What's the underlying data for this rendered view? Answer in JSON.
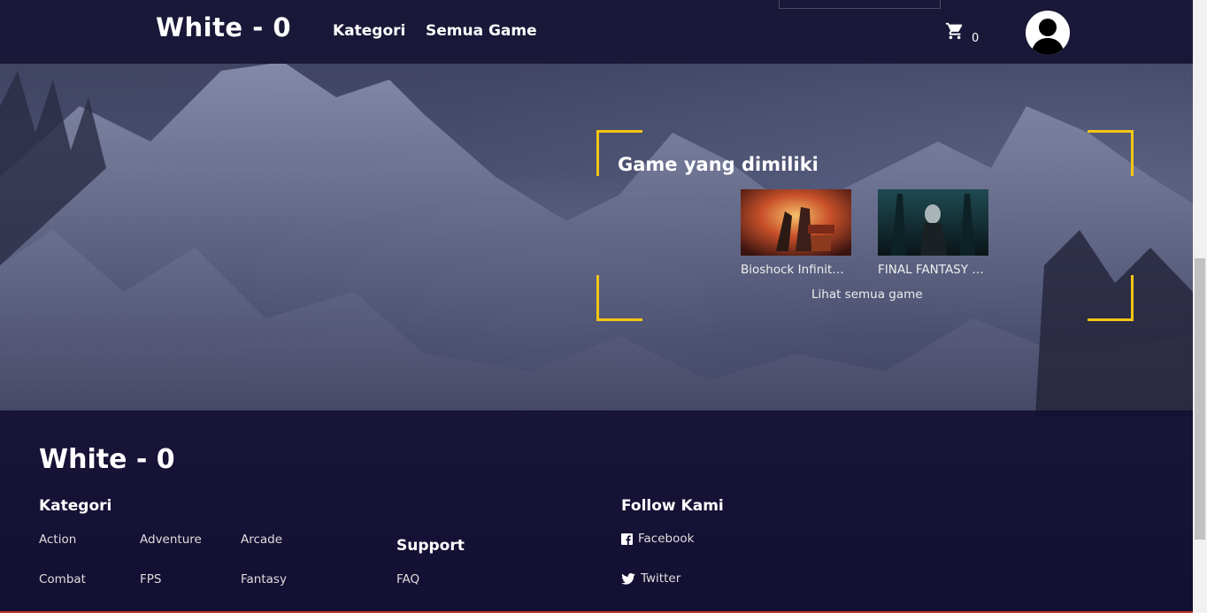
{
  "header": {
    "logo": "White - 0",
    "nav": [
      {
        "label": "Kategori"
      },
      {
        "label": "Semua Game"
      }
    ],
    "cart_count": "0"
  },
  "owned": {
    "title": "Game yang dimiliki",
    "games": [
      {
        "title": "Bioshock Infinite ..."
      },
      {
        "title": "FINAL FANTASY X..."
      }
    ],
    "see_all": "Lihat semua game"
  },
  "footer": {
    "logo": "White - 0",
    "kategori_heading": "Kategori",
    "categories": [
      "Action",
      "Adventure",
      "Arcade",
      "Combat",
      "FPS",
      "Fantasy"
    ],
    "support_heading": "Support",
    "support_links": [
      "FAQ"
    ],
    "follow_heading": "Follow Kami",
    "social": [
      {
        "label": "Facebook",
        "icon": "facebook-icon"
      },
      {
        "label": "Twitter",
        "icon": "twitter-icon"
      }
    ]
  },
  "colors": {
    "accent": "#f3c612",
    "header_bg": "#1a1838",
    "footer_bg": "#120e32"
  }
}
